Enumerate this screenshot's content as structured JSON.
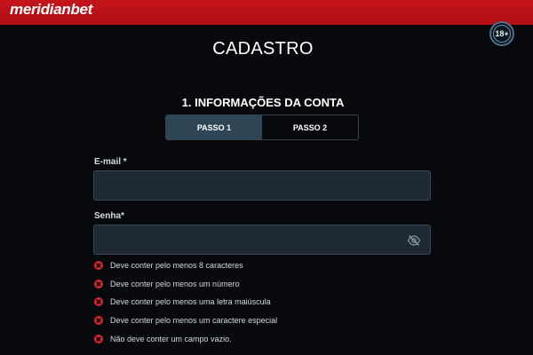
{
  "header": {
    "logo_text": "meridianbet",
    "age_badge": "18+",
    "brand_color": "#c4141b"
  },
  "page_title": "CADASTRO",
  "section_title": "1. INFORMAÇÕES DA CONTA",
  "steps": [
    {
      "label": "PASSO 1",
      "active": true
    },
    {
      "label": "PASSO 2",
      "active": false
    }
  ],
  "form": {
    "email": {
      "label": "E-mail *",
      "value": "",
      "placeholder": ""
    },
    "password": {
      "label": "Senha*",
      "value": "",
      "placeholder": "",
      "toggle_icon": "eye-slash-icon"
    }
  },
  "password_rules": [
    {
      "text": "Deve conter pelo menos 8 caracteres",
      "status": "error"
    },
    {
      "text": "Deve conter pelo menos um número",
      "status": "error"
    },
    {
      "text": "Deve conter pelo menos uma letra maiúscula",
      "status": "error"
    },
    {
      "text": "Deve conter pelo menos um caractere especial",
      "status": "error"
    },
    {
      "text": "Não deve conter um campo vazio.",
      "status": "error"
    }
  ],
  "colors": {
    "background": "#07090c",
    "active_tab": "#2d4555",
    "error": "#d8262d",
    "input_bg": "#1f2933"
  }
}
